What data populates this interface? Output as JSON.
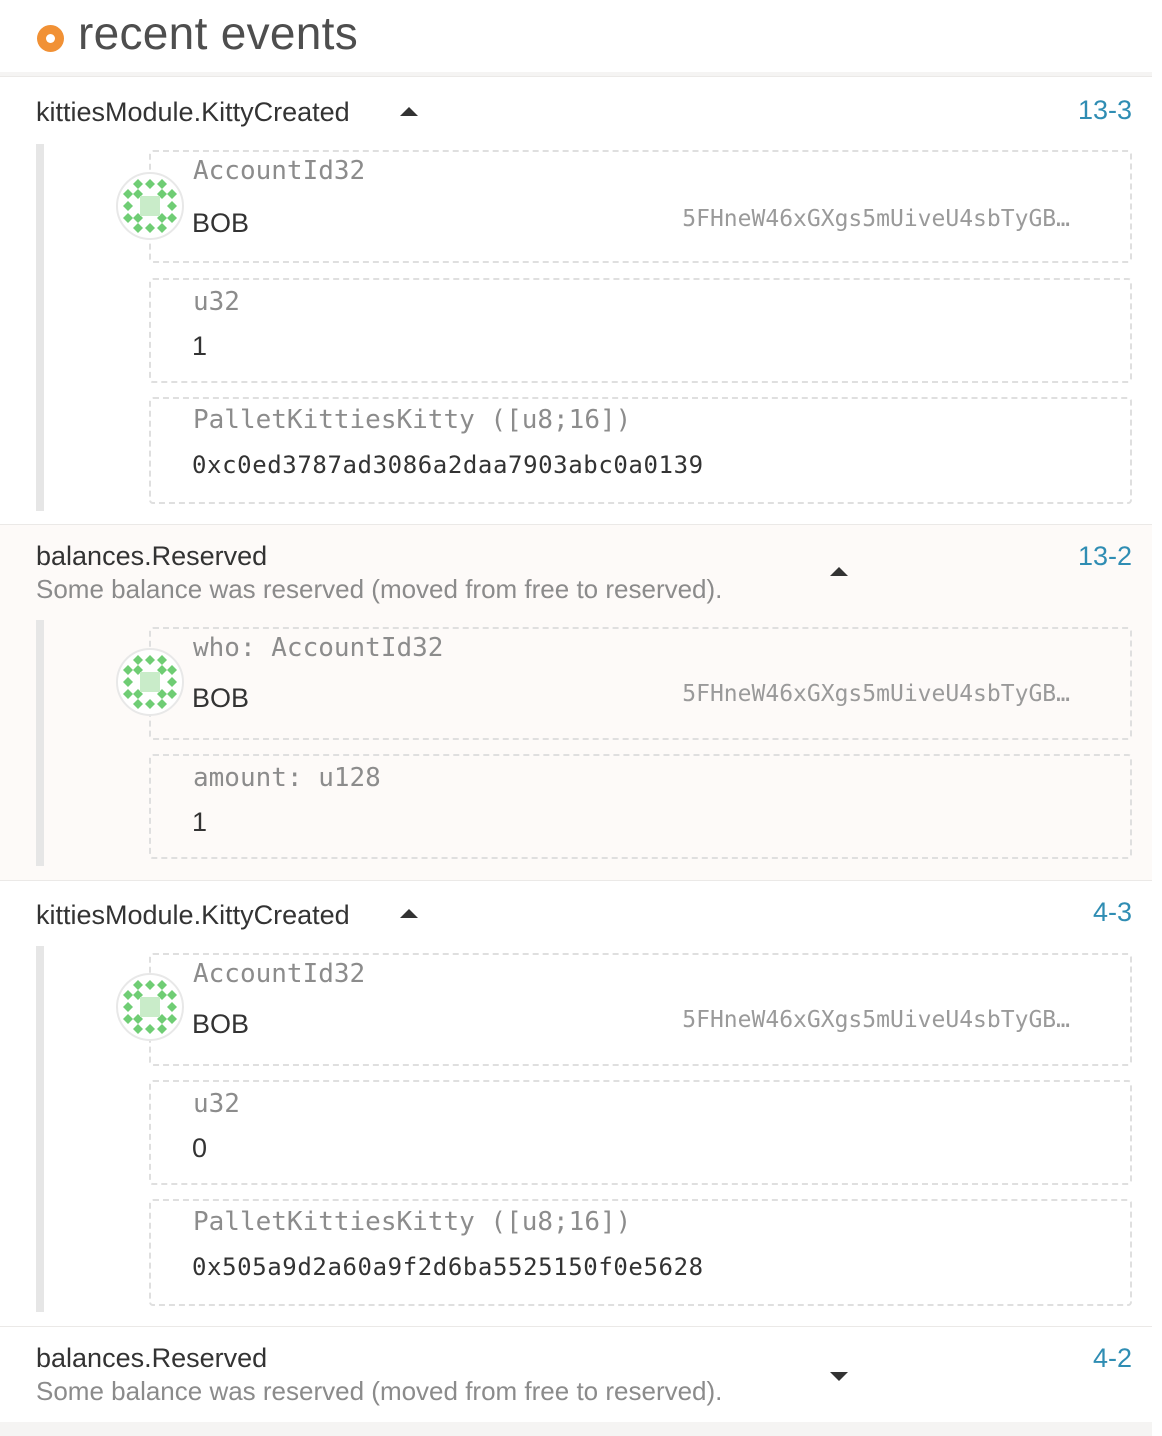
{
  "header": {
    "title": "recent events"
  },
  "events": [
    {
      "name": "kittiesModule.KittyCreated",
      "ref": "13-3",
      "fields": [
        {
          "label": "AccountId32",
          "name": "BOB",
          "address": "5FHneW46xGXgs5mUiveU4sbTyGB…"
        },
        {
          "label": "u32",
          "value": "1"
        },
        {
          "label": "PalletKittiesKitty ([u8;16])",
          "value": "0xc0ed3787ad3086a2daa7903abc0a0139"
        }
      ]
    },
    {
      "name": "balances.Reserved",
      "description": "Some balance was reserved (moved from free to reserved).",
      "ref": "13-2",
      "fields": [
        {
          "label": "who: AccountId32",
          "name": "BOB",
          "address": "5FHneW46xGXgs5mUiveU4sbTyGB…"
        },
        {
          "label": "amount: u128",
          "value": "1"
        }
      ]
    },
    {
      "name": "kittiesModule.KittyCreated",
      "ref": "4-3",
      "fields": [
        {
          "label": "AccountId32",
          "name": "BOB",
          "address": "5FHneW46xGXgs5mUiveU4sbTyGB…"
        },
        {
          "label": "u32",
          "value": "0"
        },
        {
          "label": "PalletKittiesKitty ([u8;16])",
          "value": "0x505a9d2a60a9f2d6ba5525150f0e5628"
        }
      ]
    },
    {
      "name": "balances.Reserved",
      "description": "Some balance was reserved (moved from free to reserved).",
      "ref": "4-2"
    }
  ],
  "colors": {
    "accent": "#f19135",
    "link": "#2f8db3",
    "identicon": "#6fcd74"
  }
}
